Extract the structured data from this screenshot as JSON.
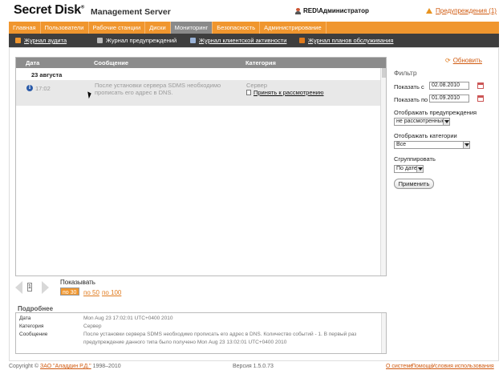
{
  "app": {
    "logo": "Secret Disk",
    "logo_mark": "®",
    "subtitle": "Management Server"
  },
  "user": {
    "name": "RED\\Администратор"
  },
  "warnings": {
    "label": "Предупреждения (1)"
  },
  "nav": [
    {
      "label": "Главная"
    },
    {
      "label": "Пользователи"
    },
    {
      "label": "Рабочие станции"
    },
    {
      "label": "Диски"
    },
    {
      "label": "Мониторинг",
      "active": true
    },
    {
      "label": "Безопасность"
    },
    {
      "label": "Администрирование"
    }
  ],
  "subnav": [
    {
      "label": "Журнал аудита",
      "icon": "audit-log-icon",
      "color": "#f0962e"
    },
    {
      "label": "Журнал предупреждений",
      "icon": "warning-log-icon",
      "color": "#bbbbbb"
    },
    {
      "label": "Журнал клиентской активности",
      "icon": "client-activity-icon",
      "color": "#9ab3d8"
    },
    {
      "label": "Журнал планов обслуживания",
      "icon": "maintenance-plan-icon",
      "color": "#e07a1c"
    }
  ],
  "grid": {
    "columns": {
      "date": "Дата",
      "message": "Сообщение",
      "category": "Категория"
    },
    "group": "23 августа",
    "rows": [
      {
        "time": "17:02",
        "message": "После установки сервера SDMS необходимо прописать его адрес в DNS.",
        "category": "Сервер",
        "action": "Принять к рассмотрению"
      }
    ]
  },
  "pager": {
    "show_label": "Показывать",
    "page": "1",
    "options": [
      "по 30",
      "по 50",
      "по 100"
    ],
    "selected": "по 30"
  },
  "details": {
    "title": "Подробнее",
    "fields": [
      {
        "label": "Дата",
        "value": "Mon Aug 23 17:02:01 UTC+0400 2010"
      },
      {
        "label": "Категория",
        "value": "Сервер"
      },
      {
        "label": "Сообщение",
        "value": "После установки сервера SDMS необходимо прописать его адрес в DNS. Количество событий - 1. В первый раз предупреждение данного типа было получено Mon Aug 23 13:02:01 UTC+0400 2010"
      }
    ]
  },
  "filter": {
    "refresh": "Обновить",
    "title": "Фильтр",
    "show_from_label": "Показать с",
    "show_from": "02.08.2010",
    "show_to_label": "Показать по",
    "show_to": "01.09.2010",
    "warnings_label": "Отображать предупреждения",
    "warnings_value": "не рассмотренные",
    "categories_label": "Отображать категории",
    "categories_value": "Все",
    "group_label": "Сгруппировать",
    "group_value": "По дате",
    "apply": "Применить"
  },
  "footer": {
    "copyright": "Copyright ©",
    "company": "ЗАО \"Аладдин Р.Д.\"",
    "years": "1998–2010",
    "version": "Версия 1.5.0.73",
    "links": [
      "О системе",
      "Помощь",
      "Условия использования"
    ]
  }
}
